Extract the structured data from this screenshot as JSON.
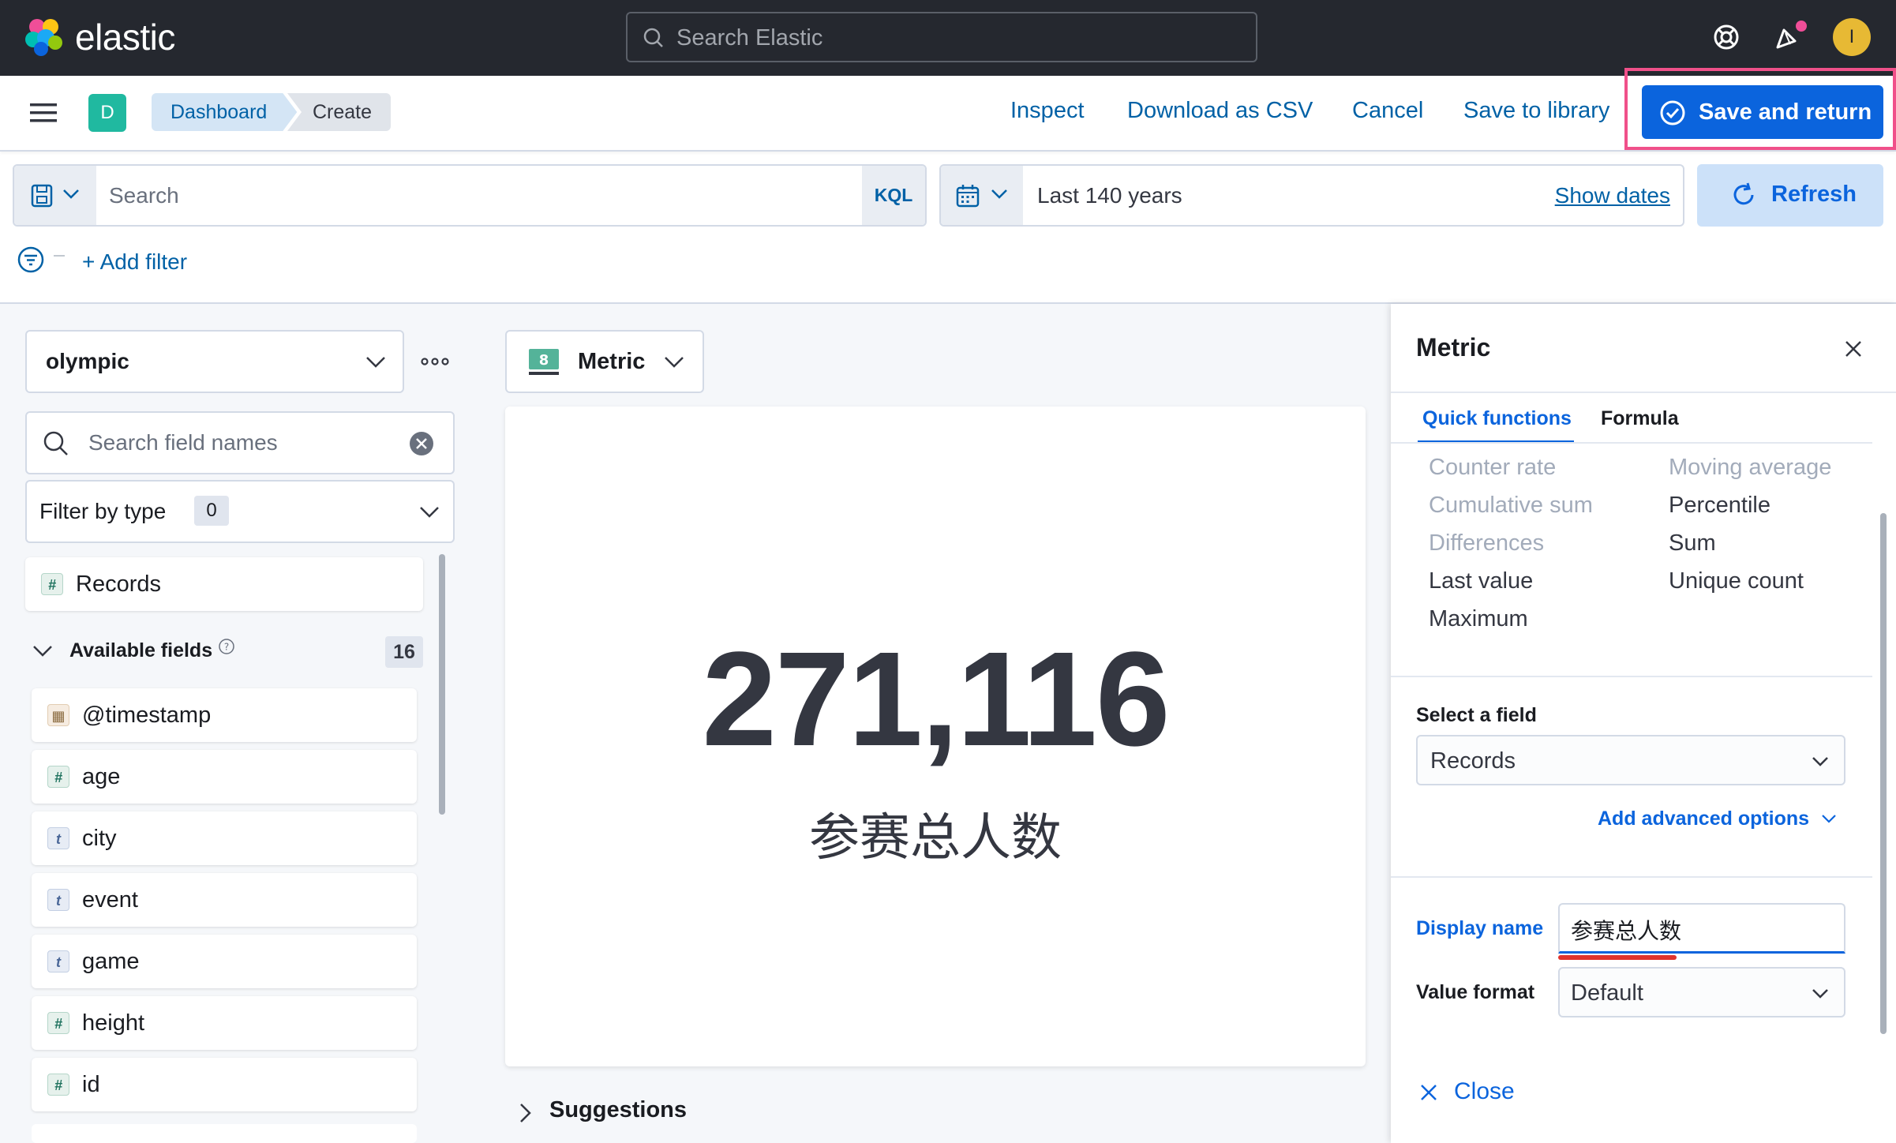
{
  "header": {
    "logo_text": "elastic",
    "search_placeholder": "Search Elastic",
    "avatar_initial": "I",
    "colors": {
      "topbar": "#25282f",
      "primary": "#0b64dd",
      "highlight": "#f0508a"
    }
  },
  "subheader": {
    "space_initial": "D",
    "breadcrumbs": [
      "Dashboard",
      "Create"
    ],
    "inspect": "Inspect",
    "download_csv": "Download as CSV",
    "cancel": "Cancel",
    "save_library": "Save to library",
    "save_return": "Save and return"
  },
  "query": {
    "search_placeholder": "Search",
    "kql": "KQL",
    "time_range": "Last 140 years",
    "show_dates": "Show dates",
    "refresh": "Refresh",
    "add_filter": "+ Add filter"
  },
  "sidebar": {
    "index_pattern": "olympic",
    "field_search_placeholder": "Search field names",
    "filter_by_type": "Filter by type",
    "filter_count": "0",
    "records": "Records",
    "available_fields_label": "Available fields",
    "available_count": "16",
    "fields": [
      {
        "name": "@timestamp",
        "type": "date"
      },
      {
        "name": "age",
        "type": "number"
      },
      {
        "name": "city",
        "type": "string"
      },
      {
        "name": "event",
        "type": "string"
      },
      {
        "name": "game",
        "type": "string"
      },
      {
        "name": "height",
        "type": "number"
      },
      {
        "name": "id",
        "type": "number"
      }
    ]
  },
  "workspace": {
    "chart_type": "Metric",
    "metric_value": "271,116",
    "metric_label": "参赛总人数",
    "suggestions": "Suggestions"
  },
  "flyout": {
    "title": "Metric",
    "tabs": [
      "Quick functions",
      "Formula"
    ],
    "functions_left": [
      {
        "label": "Counter rate",
        "enabled": false
      },
      {
        "label": "Cumulative sum",
        "enabled": false
      },
      {
        "label": "Differences",
        "enabled": false
      },
      {
        "label": "Last value",
        "enabled": true
      },
      {
        "label": "Maximum",
        "enabled": true
      }
    ],
    "functions_right": [
      {
        "label": "Moving average",
        "enabled": false
      },
      {
        "label": "Percentile",
        "enabled": true
      },
      {
        "label": "Sum",
        "enabled": true
      },
      {
        "label": "Unique count",
        "enabled": true
      }
    ],
    "select_field_label": "Select a field",
    "select_field_value": "Records",
    "advanced_options": "Add advanced options",
    "display_name_label": "Display name",
    "display_name_value": "参赛总人数",
    "value_format_label": "Value format",
    "value_format_value": "Default",
    "close": "Close"
  }
}
